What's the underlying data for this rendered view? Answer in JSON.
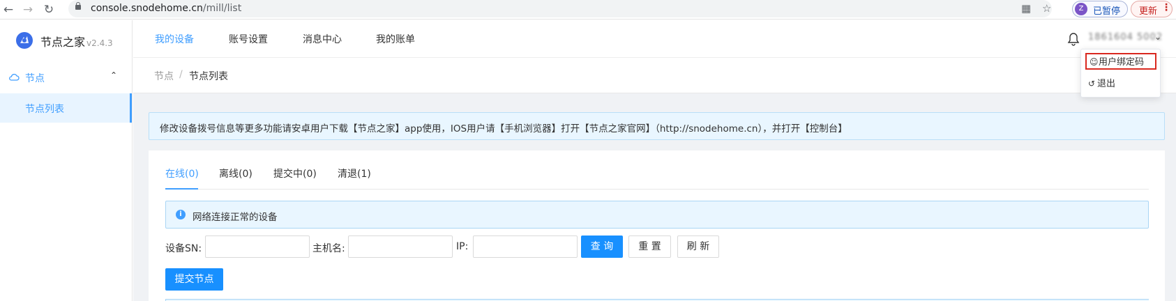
{
  "browser": {
    "url_host": "console.snodehome.cn",
    "url_path": "/mill/list",
    "profile_initial": "Z",
    "profile_label": "已暂停",
    "update_label": "更新"
  },
  "app": {
    "brand": "节点之家",
    "version": "v2.4.3"
  },
  "sidebar": {
    "group_label": "节点",
    "items": [
      {
        "label": "节点列表",
        "active": true
      }
    ]
  },
  "topnav": {
    "tabs": [
      {
        "label": "我的设备",
        "active": true
      },
      {
        "label": "账号设置",
        "active": false
      },
      {
        "label": "消息中心",
        "active": false
      },
      {
        "label": "我的账单",
        "active": false
      }
    ],
    "user_name": "1861604 5002"
  },
  "user_menu": {
    "items": [
      {
        "label": "用户绑定码",
        "icon": "user-icon",
        "highlighted": true
      },
      {
        "label": "退出",
        "icon": "logout-icon",
        "highlighted": false
      }
    ]
  },
  "breadcrumb": [
    "节点",
    "节点列表"
  ],
  "notice": "修改设备拨号信息等更多功能请安卓用户下载【节点之家】app使用，IOS用户请【手机浏览器】打开【节点之家官网】（http://snodehome.cn），并打开【控制台】",
  "status_tabs": [
    {
      "label": "在线(0)",
      "active": true
    },
    {
      "label": "离线(0)",
      "active": false
    },
    {
      "label": "提交中(0)",
      "active": false
    },
    {
      "label": "清退(1)",
      "active": false
    }
  ],
  "info_text": "网络连接正常的设备",
  "filters": {
    "sn_label": "设备SN:",
    "sn_value": "",
    "host_label": "主机名:",
    "host_value": "",
    "ip_label": "IP:",
    "ip_value": "",
    "query_button": "查 询",
    "reset_button": "重 置",
    "refresh_button": "刷 新"
  },
  "submit_button": "提交节点",
  "colors": {
    "accent": "#409eff",
    "primary_button": "#1890ff",
    "highlight_border": "#d9281f"
  }
}
